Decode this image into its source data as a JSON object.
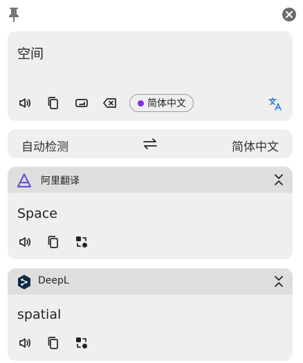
{
  "colors": {
    "card_bg": "#efefef",
    "header_bg": "#dedede",
    "accent_blue": "#3b7ddd",
    "lang_dot": "#8a2be2",
    "ali_purple": "#6b4fd8",
    "deepl_navy": "#0f2b46"
  },
  "topbar": {
    "pin_icon": "pin-icon",
    "close_icon": "close-icon"
  },
  "source": {
    "text": "空间",
    "detected_language": "简体中文",
    "tools": [
      "speaker-icon",
      "copy-icon",
      "keyboard-icon",
      "clear-icon"
    ],
    "translate_icon": "translate-icon"
  },
  "language_bar": {
    "from": "自动检测",
    "to": "简体中文",
    "swap_icon": "swap-icon"
  },
  "results": [
    {
      "service": "阿里翻译",
      "text": "Space",
      "tools": [
        "speaker-icon",
        "copy-icon",
        "retranslate-icon"
      ]
    },
    {
      "service": "DeepL",
      "text": "spatial",
      "tools": [
        "speaker-icon",
        "copy-icon",
        "retranslate-icon"
      ]
    }
  ]
}
